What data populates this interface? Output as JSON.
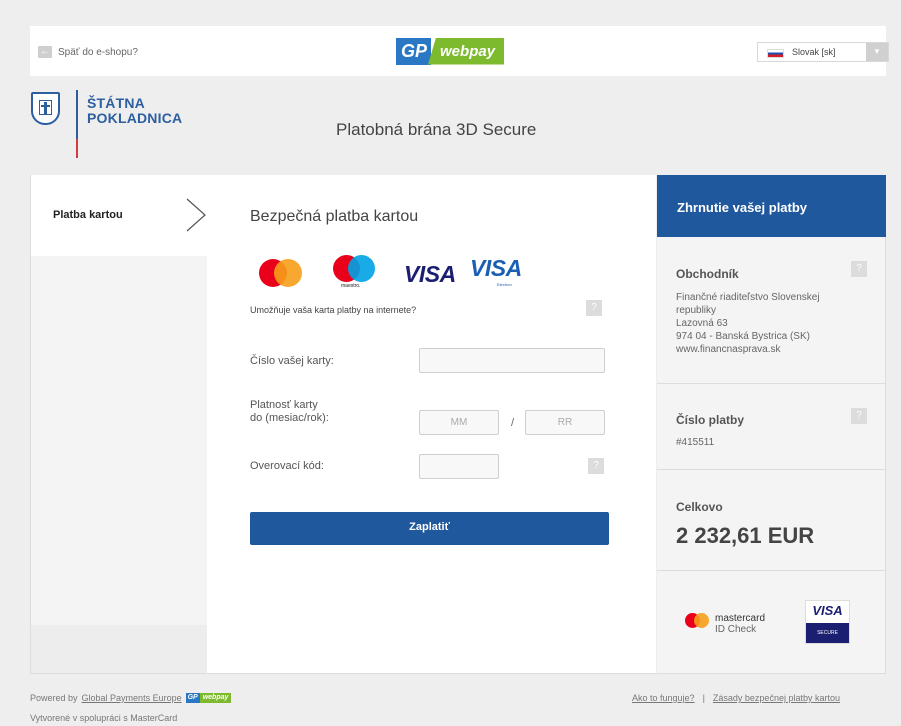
{
  "topbar": {
    "back_label": "Späť do e-shopu?",
    "back_icon": "arrow-left-icon",
    "logo_gp": "GP",
    "logo_webpay": "webpay",
    "language": "Slovak [sk]",
    "language_flag": "slovak-flag-icon"
  },
  "header": {
    "brand_line1": "ŠTÁTNA",
    "brand_line2": "POKLADNICA",
    "gateway_title": "Platobná brána 3D Secure"
  },
  "left_nav": {
    "active_step": "Platba kartou"
  },
  "main": {
    "title": "Bezpečná platba kartou",
    "card_logos": [
      "mastercard",
      "maestro",
      "VISA",
      "VISA Electron"
    ],
    "maestro_caption": "maestro.",
    "visa_label": "VISA",
    "visa_electron_label": "VISA",
    "visa_electron_sub": "Electron",
    "internet_question": "Umožňuje vaša karta platby na internete?",
    "card_number_label": "Číslo vašej karty:",
    "card_number_value": "",
    "expiry_label_line1": "Platnosť karty",
    "expiry_label_line2": "do (mesiac/rok):",
    "expiry_month_placeholder": "MM",
    "expiry_year_placeholder": "RR",
    "expiry_separator": "/",
    "cvc_label": "Overovací kód:",
    "cvc_value": "",
    "help_glyph": "?",
    "pay_button": "Zaplatiť"
  },
  "summary": {
    "header": "Zhrnutie vašej platby",
    "merchant_title": "Obchodník",
    "merchant_lines": [
      "Finančné riaditeľstvo Slovenskej",
      "republiky",
      "Lazovná 63",
      "974 04 - Banská Bystrica (SK)",
      "www.financnasprava.sk"
    ],
    "payment_number_title": "Číslo platby",
    "payment_number": "#415511",
    "total_title": "Celkovo",
    "total_amount": "2 232,61 EUR",
    "mc_id_line1": "mastercard",
    "mc_id_line2": "ID Check",
    "visa_secure_top": "VISA",
    "visa_secure_bottom": "SECURE"
  },
  "footer": {
    "powered_prefix": "Powered by",
    "powered_link": "Global Payments Europe",
    "mini_gp": "GP",
    "mini_webpay": "webpay",
    "cooperation": "Vytvorené v spolupráci s MasterCard",
    "how_it_works": "Ako to funguje?",
    "separator": "|",
    "security_policy": "Zásady bezpečnej platby kartou"
  },
  "colors": {
    "primary_blue": "#1f589d",
    "gp_blue": "#2a77c4",
    "webpay_green": "#7dba2e",
    "mc_red": "#eb001b",
    "mc_orange": "#f79e1b",
    "visa_navy": "#1a1f71"
  }
}
